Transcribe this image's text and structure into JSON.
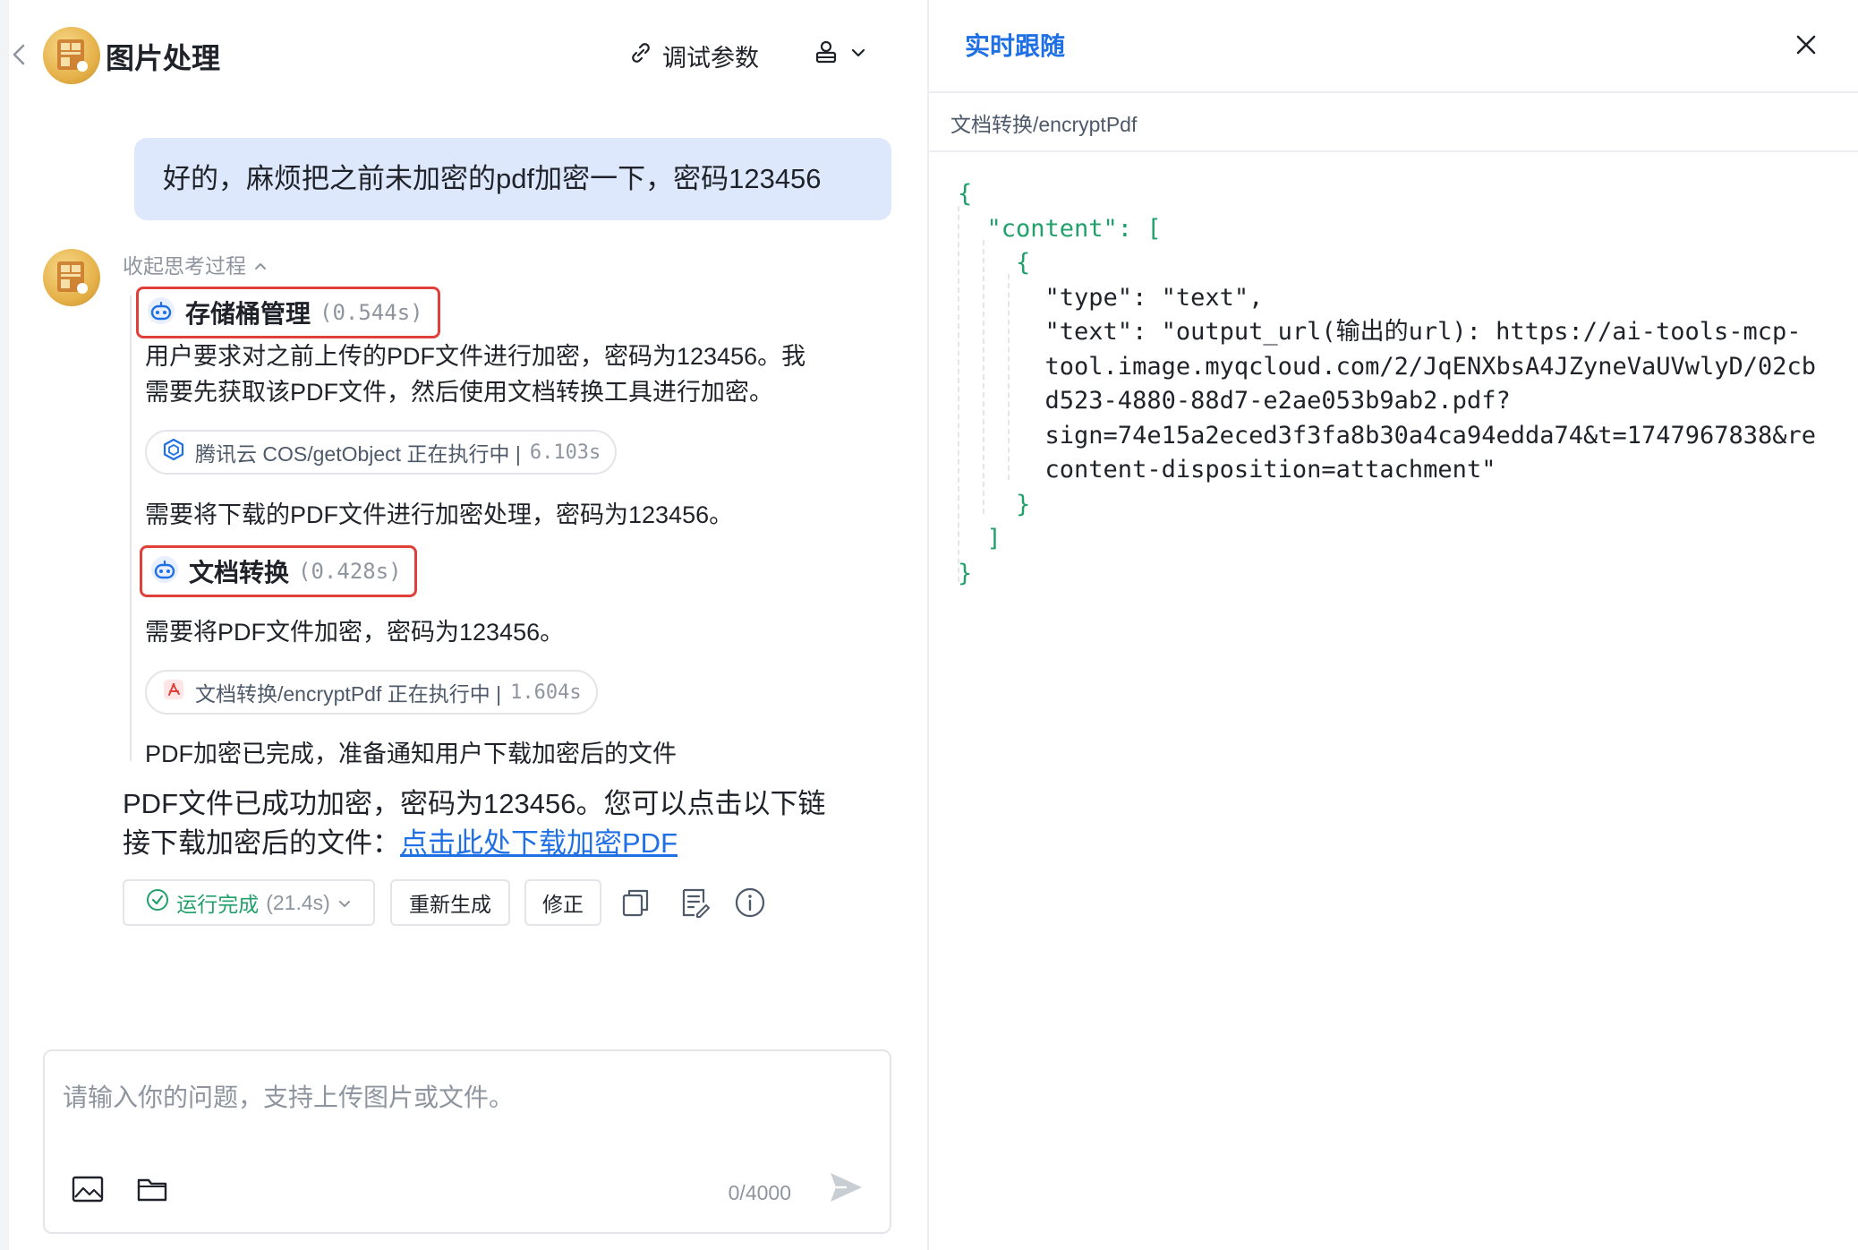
{
  "header": {
    "title": "图片处理",
    "debug_label": "调试参数"
  },
  "conversation": {
    "user_message": "好的，麻烦把之前未加密的pdf加密一下，密码123456",
    "thinking_toggle": "收起思考过程",
    "steps": [
      {
        "tool_name": "存储桶管理",
        "tool_time": "(0.544s)",
        "reasoning_line1": "用户要求对之前上传的PDF文件进行加密，密码为123456。我",
        "reasoning_line2": "需要先获取该PDF文件，然后使用文档转换工具进行加密。",
        "call_label": "腾讯云 COS/getObject 正在执行中 |",
        "call_time": "6.103s",
        "after_text": "需要将下载的PDF文件进行加密处理，密码为123456。"
      },
      {
        "tool_name": "文档转换",
        "tool_time": "(0.428s)",
        "reasoning_line1": "需要将PDF文件加密，密码为123456。",
        "call_label": "文档转换/encryptPdf 正在执行中 |",
        "call_time": "1.604s",
        "after_text": "PDF加密已完成，准备通知用户下载加密后的文件"
      }
    ],
    "answer_line1": "PDF文件已成功加密，密码为123456。您可以点击以下链",
    "answer_line2_prefix": "接下载加密后的文件：",
    "answer_link": "点击此处下载加密PDF"
  },
  "actions": {
    "status_label": "运行完成",
    "status_time": "(21.4s)",
    "regenerate_label": "重新生成",
    "correct_label": "修正"
  },
  "input": {
    "placeholder": "请输入你的问题，支持上传图片或文件。",
    "counter": "0/4000"
  },
  "side_panel": {
    "title": "实时跟随",
    "path": "文档转换/encryptPdf",
    "json_lines": [
      "{",
      "  \"content\": [",
      "    {",
      "      \"type\": \"text\",",
      "      \"text\": \"output_url(输出的url): https://ai-tools-mcp-",
      "      tool.image.myqcloud.com/2/JqENXbsA4JZyneVaUVwlyD/02cb",
      "      d523-4880-88d7-e2ae053b9ab2.pdf?",
      "      sign=74e15a2eced3f3fa8b30a4ca94edda74&t=1747967838&re",
      "      content-disposition=attachment\"",
      "    }",
      "  ]",
      "}"
    ]
  },
  "colors": {
    "accent": "#1f6fe5",
    "highlight_border": "#e0403a",
    "user_bubble": "#dde8fd",
    "success": "#22a06b",
    "json_green": "#22a06b"
  },
  "icons": [
    "back-icon",
    "app-avatar",
    "link-icon",
    "user-icon",
    "chevron-down-icon",
    "chevron-up-icon",
    "robot-icon",
    "cube-icon",
    "pdf-icon",
    "check-circle-icon",
    "copy-icon",
    "note-icon",
    "info-icon",
    "image-icon",
    "folder-icon",
    "send-icon",
    "close-icon"
  ]
}
